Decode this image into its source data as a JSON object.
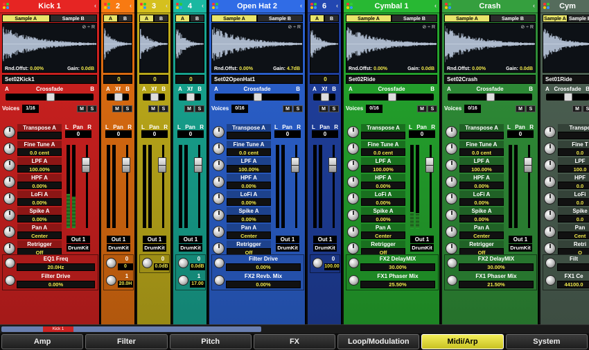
{
  "channels": [
    {
      "name": "Kick 1",
      "setname": "Set02Kick1",
      "color": "#c8201e",
      "xf_label": "Crossfade",
      "voices": "1/16",
      "pan": "0",
      "params": [
        {
          "label": "Transpose A",
          "value": ""
        },
        {
          "label": "Fine Tune A",
          "value": "0.0 cent"
        },
        {
          "label": "LPF A",
          "value": "100.00%"
        },
        {
          "label": "HPF A",
          "value": "0.00%"
        },
        {
          "label": "LoFi A",
          "value": "0.00%"
        },
        {
          "label": "Spike A",
          "value": "0.00%"
        },
        {
          "label": "Pan A",
          "value": "Center"
        },
        {
          "label": "Retrigger",
          "value": "Off"
        }
      ],
      "rnd": "0.00%",
      "gain": "0.0dB",
      "fx": [
        {
          "label": "EQ1 Freq",
          "value": "20.0Hz"
        },
        {
          "label": "Filter Drive",
          "value": "0.00%"
        }
      ],
      "out": "Out 1",
      "kit": "DrumKit"
    },
    {
      "name": "2",
      "color": "#d86a10",
      "fx_vals": [
        "0",
        "1"
      ],
      "fx_sub": [
        "0",
        "20.0H"
      ]
    },
    {
      "name": "3",
      "color": "#b9a71a",
      "fx_vals": [
        "0"
      ],
      "fx_sub": [
        "0.0dB"
      ]
    },
    {
      "name": "4",
      "color": "#17a08c",
      "fx_vals": [
        "0",
        "1"
      ],
      "fx_sub": [
        "0.0dB",
        "17.00"
      ]
    },
    {
      "name": "Open Hat 2",
      "setname": "Set02OpenHat1",
      "color": "#2a5ec8",
      "xf_label": "Crossfade",
      "voices": "0/16",
      "pan": "0",
      "params": [
        {
          "label": "Transpose A",
          "value": ""
        },
        {
          "label": "Fine Tune A",
          "value": "0.0 cent"
        },
        {
          "label": "LPF A",
          "value": "100.00%"
        },
        {
          "label": "HPF A",
          "value": "0.00%"
        },
        {
          "label": "LoFi A",
          "value": "0.00%"
        },
        {
          "label": "Spike A",
          "value": "0.00%"
        },
        {
          "label": "Pan A",
          "value": "Center"
        },
        {
          "label": "Retrigger",
          "value": "Off"
        }
      ],
      "rnd": "0.00%",
      "gain": "4.7dB",
      "fx": [
        {
          "label": "Filter Drive",
          "value": "0.00%"
        },
        {
          "label": "FX2 Revb. Mix",
          "value": "0.00%"
        }
      ],
      "out": "Out 1",
      "kit": "DrumKit"
    },
    {
      "name": "6",
      "color": "#1e3e9a",
      "fx_vals": [
        "0"
      ],
      "fx_sub": [
        "100.00"
      ]
    },
    {
      "name": "Cymbal 1",
      "setname": "Set02Ride",
      "color": "#23a02c",
      "xf_label": "Crossfade",
      "voices": "0/16",
      "pan": "0",
      "params": [
        {
          "label": "Transpose A",
          "value": ""
        },
        {
          "label": "Fine Tune A",
          "value": "0.0 cent"
        },
        {
          "label": "LPF A",
          "value": "100.00%"
        },
        {
          "label": "HPF A",
          "value": "0.00%"
        },
        {
          "label": "LoFi A",
          "value": "0.00%"
        },
        {
          "label": "Spike A",
          "value": "0.00%"
        },
        {
          "label": "Pan A",
          "value": "Center"
        },
        {
          "label": "Retrigger",
          "value": "Off"
        }
      ],
      "rnd": "0.00%",
      "gain": "0.0dB",
      "fx": [
        {
          "label": "FX2 DelayMIX",
          "value": "30.00%"
        },
        {
          "label": "FX1 Phaser Mix",
          "value": "25.50%"
        }
      ],
      "out": "Out 1",
      "kit": "DrumKit"
    },
    {
      "name": "Crash",
      "setname": "Set02Crash",
      "color": "#2e8a36",
      "xf_label": "Crossfade",
      "voices": "0/16",
      "pan": "0",
      "params": [
        {
          "label": "Transpose A",
          "value": ""
        },
        {
          "label": "Fine Tune A",
          "value": "0.0 cent"
        },
        {
          "label": "LPF A",
          "value": "100.00%"
        },
        {
          "label": "HPF A",
          "value": "0.00%"
        },
        {
          "label": "LoFi A",
          "value": "0.00%"
        },
        {
          "label": "Spike A",
          "value": "0.00%"
        },
        {
          "label": "Pan A",
          "value": "Center"
        },
        {
          "label": "Retrigger",
          "value": "Off"
        }
      ],
      "rnd": "0.00%",
      "gain": "0.0dB",
      "fx": [
        {
          "label": "FX2 DelayMIX",
          "value": "30.00%"
        },
        {
          "label": "FX1 Phaser Mix",
          "value": "21.50%"
        }
      ],
      "out": "Out 1",
      "kit": "DrumKit"
    },
    {
      "name": "Cym",
      "setname": "Set01Ride",
      "color": "#4a5e50",
      "xf_label": "Crossfade",
      "voices": "",
      "pan": "",
      "params": [
        {
          "label": "Transpo",
          "value": ""
        },
        {
          "label": "Fine T",
          "value": "0.0"
        },
        {
          "label": "LPF",
          "value": "100.0"
        },
        {
          "label": "HPF",
          "value": "0.0"
        },
        {
          "label": "LoFi",
          "value": "0.0"
        },
        {
          "label": "Spike",
          "value": "0.0"
        },
        {
          "label": "Pan",
          "value": "Cent"
        },
        {
          "label": "Retri",
          "value": "O"
        }
      ],
      "rnd": "",
      "gain": "",
      "fx": [
        {
          "label": "Filt",
          "value": ""
        },
        {
          "label": "FX1 Ce",
          "value": "44100.0"
        }
      ],
      "out": "",
      "kit": ""
    }
  ],
  "common": {
    "sample_a": "Sample A",
    "sample_b": "Sample B",
    "a": "A",
    "b": "B",
    "xf": "Xf",
    "voices": "Voices",
    "pan": "Pan",
    "l": "L",
    "r": "R",
    "m": "M",
    "s": "S",
    "rnd": "Rnd.Offst:",
    "gain": "Gain:",
    "ctl": "⊘ ÷ R",
    "out": "Out 1",
    "kit": "DrumKit",
    "zero": "0"
  },
  "scroll_marker": "Kick 1",
  "tabs": [
    "Amp",
    "Filter",
    "Pitch",
    "FX",
    "Loop/Modulation",
    "Midi/Arp",
    "System"
  ],
  "active_tab": "Midi/Arp"
}
